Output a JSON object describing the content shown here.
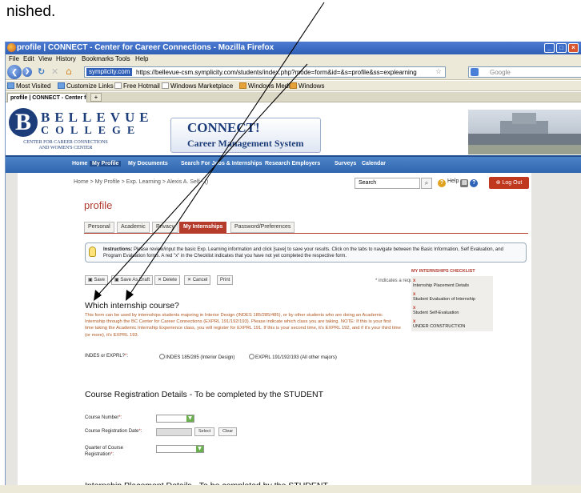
{
  "caption": "nished.",
  "window": {
    "title": "profile | CONNECT - Center for Career Connections - Mozilla Firefox"
  },
  "menu": [
    "File",
    "Edit",
    "View",
    "History",
    "Bookmarks",
    "Tools",
    "Help"
  ],
  "nav": {
    "site_badge": "symplicity.com",
    "url": "https://bellevue-csm.symplicity.com/students/index.php?mode=form&id=&s=profile&ss=explearning",
    "search_placeholder": "Google"
  },
  "bookmarks": [
    "Most Visited",
    "Customize Links",
    "Free Hotmail",
    "Windows Marketplace",
    "Windows Media",
    "Windows"
  ],
  "tab": {
    "label": "profile | CONNECT - Center for C...",
    "new": "+"
  },
  "header": {
    "logo_b": "B",
    "line1": "BELLEVUE",
    "line2": "COLLEGE",
    "center_line1": "CENTER FOR CAREER CONNECTIONS",
    "center_line2": "AND WOMEN'S CENTER",
    "connect": "CONNECT!",
    "cms": "Career Management System"
  },
  "sitenav": [
    "Home",
    "My Profile",
    "My Documents",
    "Search For Jobs & Internships",
    "Research Employers",
    "Surveys",
    "Calendar"
  ],
  "breadcrumb": "Home > My Profile > Exp. Learning > Alexis A. Self - ()",
  "search": {
    "value": "Search",
    "help": "Help",
    "logout": "Log Out"
  },
  "page_title": "profile",
  "profile_tabs": [
    "Personal",
    "Academic",
    "Privacy",
    "My Internships",
    "Password/Preferences"
  ],
  "instructions": {
    "bold": "Instructions:",
    "text": " Please review/input the basic Exp. Learning information and click [save] to save your results. Click on the tabs to navigate between the Basic Information, Self Evaluation, and Program Evaluation forms. A red \"x\" in the Checklist indicates that you have not yet completed the respective form."
  },
  "actions": [
    "Save",
    "Save As Draft",
    "Delete",
    "Cancel",
    "Print"
  ],
  "required_note": "* indicates a required field",
  "checklist": {
    "title": "MY INTERNSHIPS CHECKLIST",
    "mark": "x",
    "items": [
      "Internship Placement Details",
      "Student Evaluation of Internship",
      "Student Self-Evaluation",
      "UNDER CONSTRUCTION"
    ]
  },
  "section1": {
    "title": "Which internship course?",
    "text": "This form can be used by internships students majoring in Interior Design (INDES 185/285/485), or by other students who are doing an Academic Internship through the BC Center for Career Connections (EXPRL 191/192/193). Please indicate which class you are taking. NOTE: If this is your first time taking the Academic Internship Experience class, you will register for EXPRL 191. If this is your second time, it's EXPRL 192, and if it's your third time (or more), it's EXPRL 193.",
    "label": "INDES or EXPRL?",
    "option1": "INDES 185/285 (Interior Design)",
    "option2": "EXPRL 191/192/193 (All other majors)"
  },
  "section2": {
    "title": "Course Registration Details - To be completed by the STUDENT",
    "course_number": "Course Number",
    "reg_date": "Course Registration Date",
    "select": "Select",
    "clear": "Clear",
    "quarter1": "Quarter of Course",
    "quarter2": "Registration"
  },
  "section3": {
    "title": "Internship Placement Details - To be completed by the STUDENT"
  },
  "req": "*"
}
